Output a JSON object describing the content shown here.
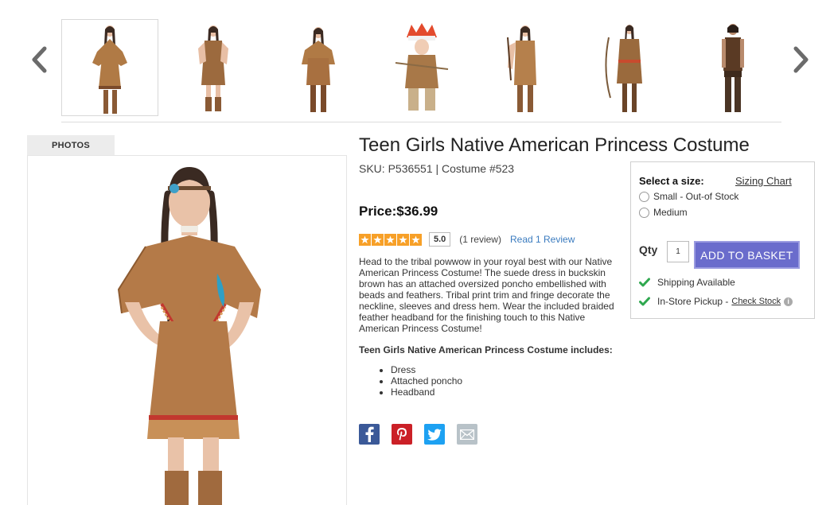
{
  "carousel": {
    "prev_icon": "chevron-left-icon",
    "next_icon": "chevron-right-icon",
    "thumbnails": [
      {
        "name": "thumb-teen-princess",
        "selected": true
      },
      {
        "name": "thumb-girls-princess"
      },
      {
        "name": "thumb-child-princess"
      },
      {
        "name": "thumb-toddler-chief"
      },
      {
        "name": "thumb-adult-princess"
      },
      {
        "name": "thumb-adult-dress"
      },
      {
        "name": "thumb-adult-warrior"
      }
    ]
  },
  "photos": {
    "tab_label": "PHOTOS"
  },
  "product": {
    "title": "Teen Girls Native American Princess Costume",
    "sku": "SKU: P536551  |  Costume #523",
    "price": "Price:$36.99",
    "rating": {
      "score": "5.0",
      "stars": 5,
      "review_count": "(1 review)",
      "read_review": "Read 1 Review"
    },
    "description": "Head to the tribal powwow in your royal best with our Native American Princess Costume! The suede dress in buckskin brown has an attached oversized poncho embellished with beads and feathers. Tribal print trim and fringe decorate the neckline, sleeves and dress hem. Wear the included braided feather headband for the finishing touch to this Native American Princess Costume!",
    "includes_heading": "Teen Girls Native American Princess Costume includes:",
    "includes": [
      "Dress",
      "Attached poncho",
      "Headband"
    ]
  },
  "social": [
    {
      "name": "facebook-icon",
      "color": "#3b5998"
    },
    {
      "name": "pinterest-icon",
      "color": "#cb2027"
    },
    {
      "name": "twitter-icon",
      "color": "#1da1f2"
    },
    {
      "name": "email-icon",
      "color": "#b8c2c8"
    }
  ],
  "buybox": {
    "select_label": "Select a size:",
    "sizing_chart": "Sizing Chart",
    "sizes": [
      "Small - Out-of Stock",
      "Medium"
    ],
    "qty_label": "Qty",
    "qty_value": "1",
    "add_button": "ADD TO BASKET",
    "shipping": "Shipping Available",
    "pickup": "In-Store Pickup -",
    "check_stock": "Check Stock",
    "accent_color": "#6a6ccc",
    "check_color": "#2fa84f"
  }
}
